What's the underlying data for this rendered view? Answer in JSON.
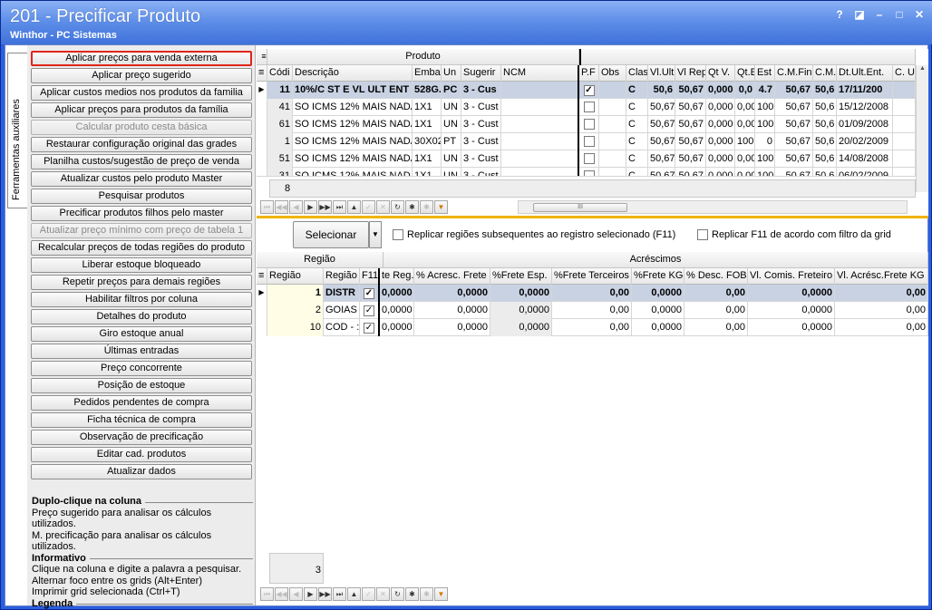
{
  "window": {
    "title": "201 - Precificar Produto",
    "subtitle": "Winthor - PC Sistemas",
    "buttons": [
      "?",
      "◪",
      "–",
      "□",
      "✕"
    ]
  },
  "side_tab": {
    "label": "Ferramentas auxiliares"
  },
  "actions": [
    {
      "label": "Aplicar preços para venda externa",
      "state": "focused"
    },
    {
      "label": "Aplicar preço sugerido",
      "state": "normal"
    },
    {
      "label": "Aplicar custos medios nos produtos da familia",
      "state": "normal"
    },
    {
      "label": "Aplicar preços para produtos da família",
      "state": "normal"
    },
    {
      "label": "Calcular produto cesta básica",
      "state": "disabled"
    },
    {
      "label": "Restaurar configuração original das grades",
      "state": "normal"
    },
    {
      "label": "Planilha custos/sugestão de preço de venda",
      "state": "normal"
    },
    {
      "label": "Atualizar custos pelo produto Master",
      "state": "normal"
    },
    {
      "label": "Pesquisar produtos",
      "state": "normal"
    },
    {
      "label": "Precificar produtos filhos pelo master",
      "state": "normal"
    },
    {
      "label": "Atualizar preço mínimo com preço de tabela 1",
      "state": "disabled"
    },
    {
      "label": "Recalcular preços de todas regiões do produto",
      "state": "normal"
    },
    {
      "label": "Liberar estoque bloqueado",
      "state": "normal"
    },
    {
      "label": "Repetir preços para demais regiões",
      "state": "normal"
    },
    {
      "label": "Habilitar filtros por coluna",
      "state": "normal"
    },
    {
      "label": "Detalhes do produto",
      "state": "normal"
    },
    {
      "label": "Giro estoque anual",
      "state": "normal"
    },
    {
      "label": "Últimas entradas",
      "state": "normal"
    },
    {
      "label": "Preço concorrente",
      "state": "normal"
    },
    {
      "label": "Posição de estoque",
      "state": "normal"
    },
    {
      "label": "Pedidos pendentes de compra",
      "state": "normal"
    },
    {
      "label": "Ficha técnica de compra",
      "state": "normal"
    },
    {
      "label": "Observação de precificação",
      "state": "normal"
    },
    {
      "label": "Editar cad. produtos",
      "state": "normal"
    },
    {
      "label": "Atualizar dados",
      "state": "normal"
    }
  ],
  "help": {
    "h1": "Duplo-clique na coluna",
    "l1": "Preço sugerido para analisar os cálculos utilizados.",
    "l2": "M. precificação para analisar os cálculos utilizados.",
    "h2": "Informativo",
    "l3": "Clique na coluna e digite a palavra a pesquisar.",
    "l4": "Alternar foco entre os grids (Alt+Enter)",
    "l5": "Imprimir grid selecionada (Ctrl+T)",
    "h3": "Legenda"
  },
  "products": {
    "band_label": "Produto",
    "columns": [
      "Códi",
      "Descrição",
      "Emba",
      "Un",
      "Sugerir",
      "NCM",
      "P.F",
      "Obs",
      "Clas",
      "Vl.Ult",
      "Vl Repo",
      "Qt V.",
      "Qt.E",
      "Est",
      "C.M.Fin",
      "C.M.",
      "Dt.Ult.Ent.",
      "C. U"
    ],
    "rows": [
      {
        "cod": "11",
        "desc": "10%/C ST E VL ULT ENT",
        "emb": "528G.",
        "un": "PC",
        "sug": "3 - Cus",
        "ncm": "",
        "pf": "✓",
        "obs": "",
        "clas": "C",
        "vlult": "50,6",
        "vlrep": "50,67",
        "qtv": "0,000",
        "qte": "0,0",
        "est": "4.7",
        "cmfin": "50,67",
        "cm": "50,6",
        "dt": "17/11/200",
        "cu": ""
      },
      {
        "cod": "41",
        "desc": "SO ICMS 12% MAIS NADA",
        "emb": "1X1",
        "un": "UN",
        "sug": "3 - Cust",
        "ncm": "",
        "pf": "",
        "obs": "",
        "clas": "C",
        "vlult": "50,67",
        "vlrep": "50,67",
        "qtv": "0,000",
        "qte": "0,00",
        "est": "100",
        "cmfin": "50,67",
        "cm": "50,6",
        "dt": "15/12/2008",
        "cu": ""
      },
      {
        "cod": "61",
        "desc": "SO ICMS 12% MAIS NADA",
        "emb": "1X1",
        "un": "UN",
        "sug": "3 - Cust",
        "ncm": "",
        "pf": "",
        "obs": "",
        "clas": "C",
        "vlult": "50,67",
        "vlrep": "50,67",
        "qtv": "0,000",
        "qte": "0,00",
        "est": "100",
        "cmfin": "50,67",
        "cm": "50,6",
        "dt": "01/09/2008",
        "cu": ""
      },
      {
        "cod": "1",
        "desc": "SO ICMS 12% MAIS NADA",
        "emb": "30X02",
        "un": "PT",
        "sug": "3 - Cust",
        "ncm": "",
        "pf": "",
        "obs": "",
        "clas": "C",
        "vlult": "50,67",
        "vlrep": "50,67",
        "qtv": "0,000",
        "qte": "100",
        "est": "0",
        "cmfin": "50,67",
        "cm": "50,6",
        "dt": "20/02/2009",
        "cu": ""
      },
      {
        "cod": "51",
        "desc": "SO ICMS 12% MAIS NADA",
        "emb": "1X1",
        "un": "UN",
        "sug": "3 - Cust",
        "ncm": "",
        "pf": "",
        "obs": "",
        "clas": "C",
        "vlult": "50,67",
        "vlrep": "50,67",
        "qtv": "0,000",
        "qte": "0,00",
        "est": "100",
        "cmfin": "50,67",
        "cm": "50,6",
        "dt": "14/08/2008",
        "cu": ""
      },
      {
        "cod": "31",
        "desc": "SO ICMS 12% MAIS NADA",
        "emb": "1X1",
        "un": "UN",
        "sug": "3 - Cust",
        "ncm": "",
        "pf": "",
        "obs": "",
        "clas": "C",
        "vlult": "50,67",
        "vlrep": "50,67",
        "qtv": "0,000",
        "qte": "0,00",
        "est": "100",
        "cmfin": "50,67",
        "cm": "50,6",
        "dt": "06/02/2009",
        "cu": ""
      }
    ],
    "count": "8"
  },
  "middle": {
    "select_button": "Selecionar",
    "replicate_label": "Replicar regiões subsequentes ao registro selecionado (F11)",
    "replicate_filter_label": "Replicar F11 de acordo com filtro da grid"
  },
  "regions": {
    "band_region": "Região",
    "band_extras": "Acréscimos",
    "columns": [
      "Região",
      "Região",
      "F11",
      "te Reg.",
      "% Acresc. Frete",
      "%Frete Esp.",
      "%Frete Terceiros",
      "%Frete KG",
      "% Desc. FOB",
      "Vl. Comis. Freteiro",
      "Vl. Acrésc.Frete KG"
    ],
    "rows": [
      {
        "reg": "1",
        "name": "DISTR",
        "f11": "✓",
        "treg": "0,0000",
        "acr": "0,0000",
        "esp": "0,0000",
        "ter": "0,00",
        "kg": "0,0000",
        "fob": "0,00",
        "com": "0,0000",
        "akg": "0,00"
      },
      {
        "reg": "2",
        "name": "GOIAS",
        "f11": "✓",
        "treg": "0,0000",
        "acr": "0,0000",
        "esp": "0,0000",
        "ter": "0,00",
        "kg": "0,0000",
        "fob": "0,00",
        "com": "0,0000",
        "akg": "0,00"
      },
      {
        "reg": "10",
        "name": "COD - :",
        "f11": "✓",
        "treg": "0,0000",
        "acr": "0,0000",
        "esp": "0,0000",
        "ter": "0,00",
        "kg": "0,0000",
        "fob": "0,00",
        "com": "0,0000",
        "akg": "0,00"
      }
    ],
    "count": "3"
  },
  "colors": {
    "title_bar": "#3f72db",
    "selected_row": "#c8d2e3",
    "focus_border": "#e0251b"
  }
}
